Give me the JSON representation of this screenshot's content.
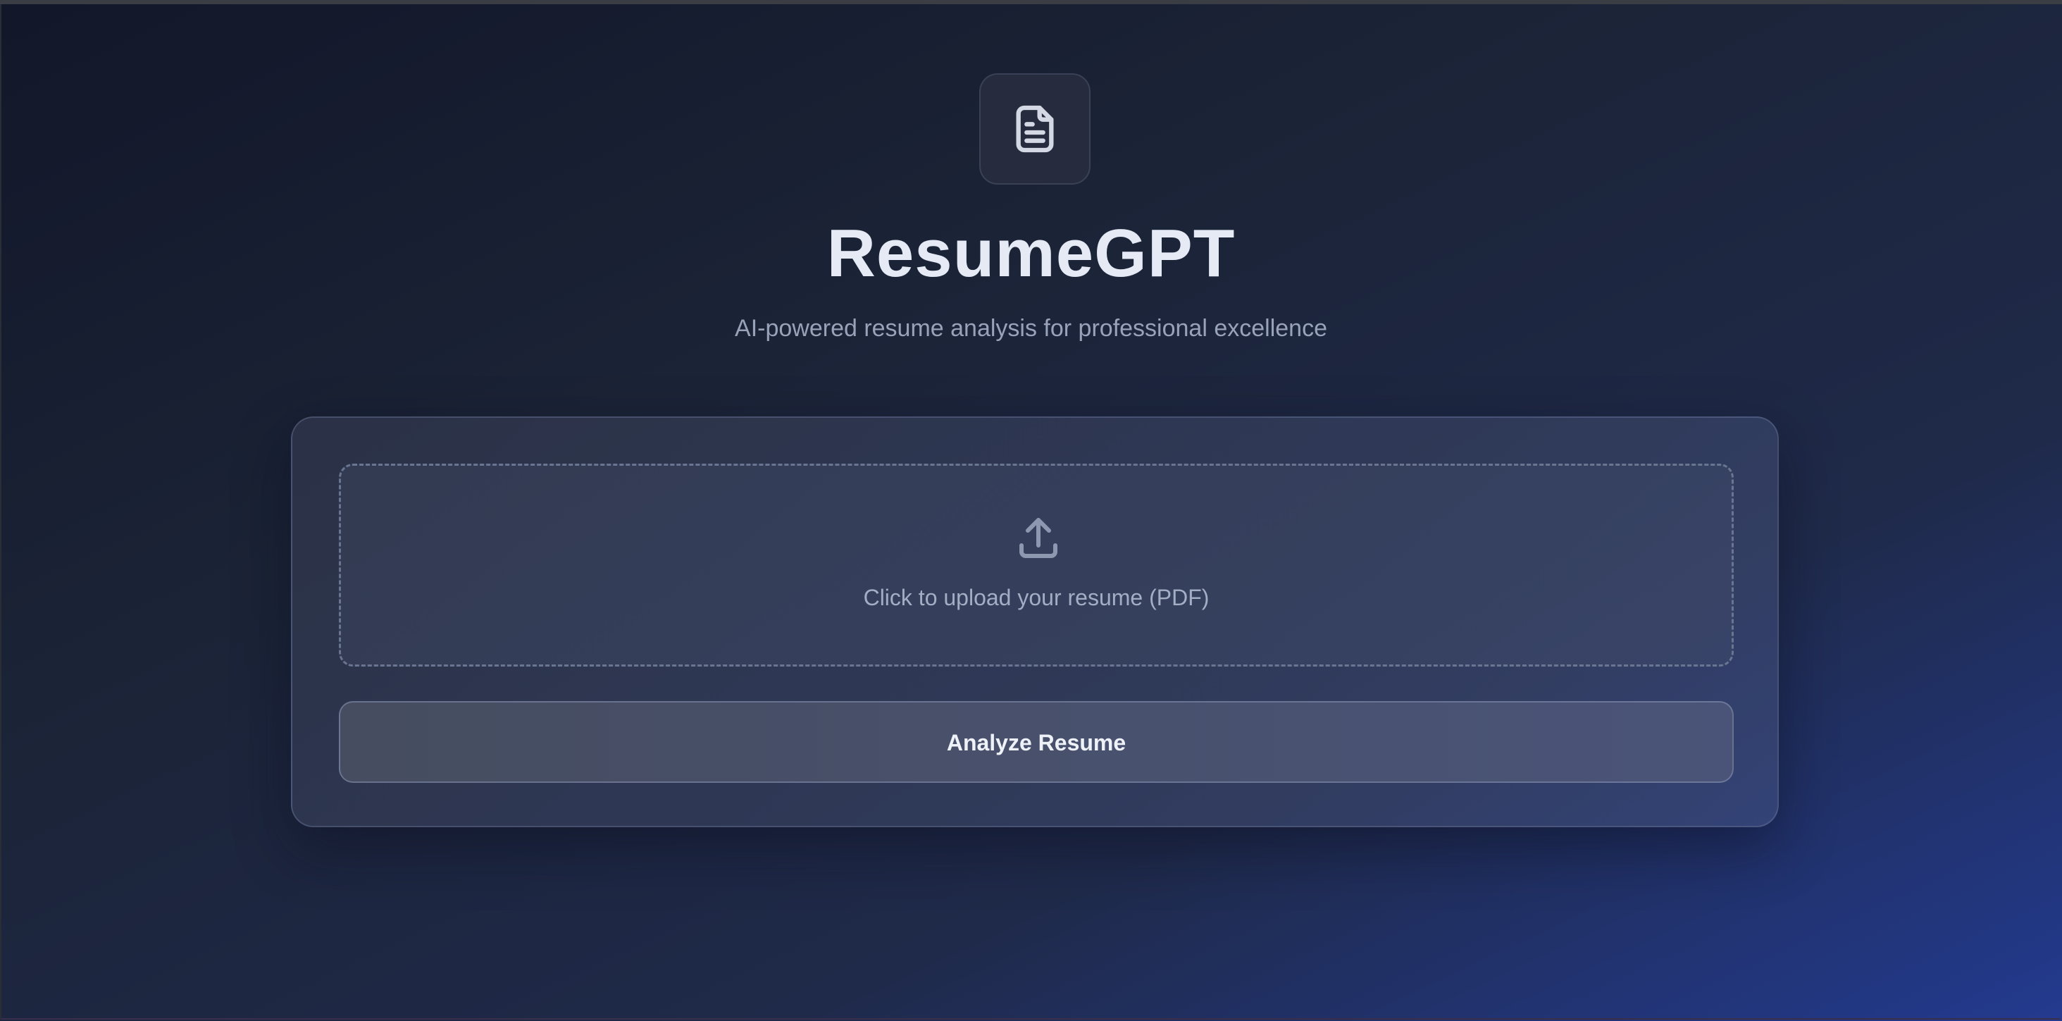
{
  "header": {
    "logo_icon": "document-icon",
    "title": "ResumeGPT",
    "subtitle": "AI-powered resume analysis for professional excellence"
  },
  "upload": {
    "icon": "upload-icon",
    "label": "Click to upload your resume (PDF)"
  },
  "actions": {
    "analyze_label": "Analyze Resume"
  },
  "colors": {
    "background_start": "#121729",
    "background_end": "#233a8f",
    "title": "#e5eaf4",
    "muted_text": "#98a2b8",
    "card_border": "#5d6788"
  }
}
